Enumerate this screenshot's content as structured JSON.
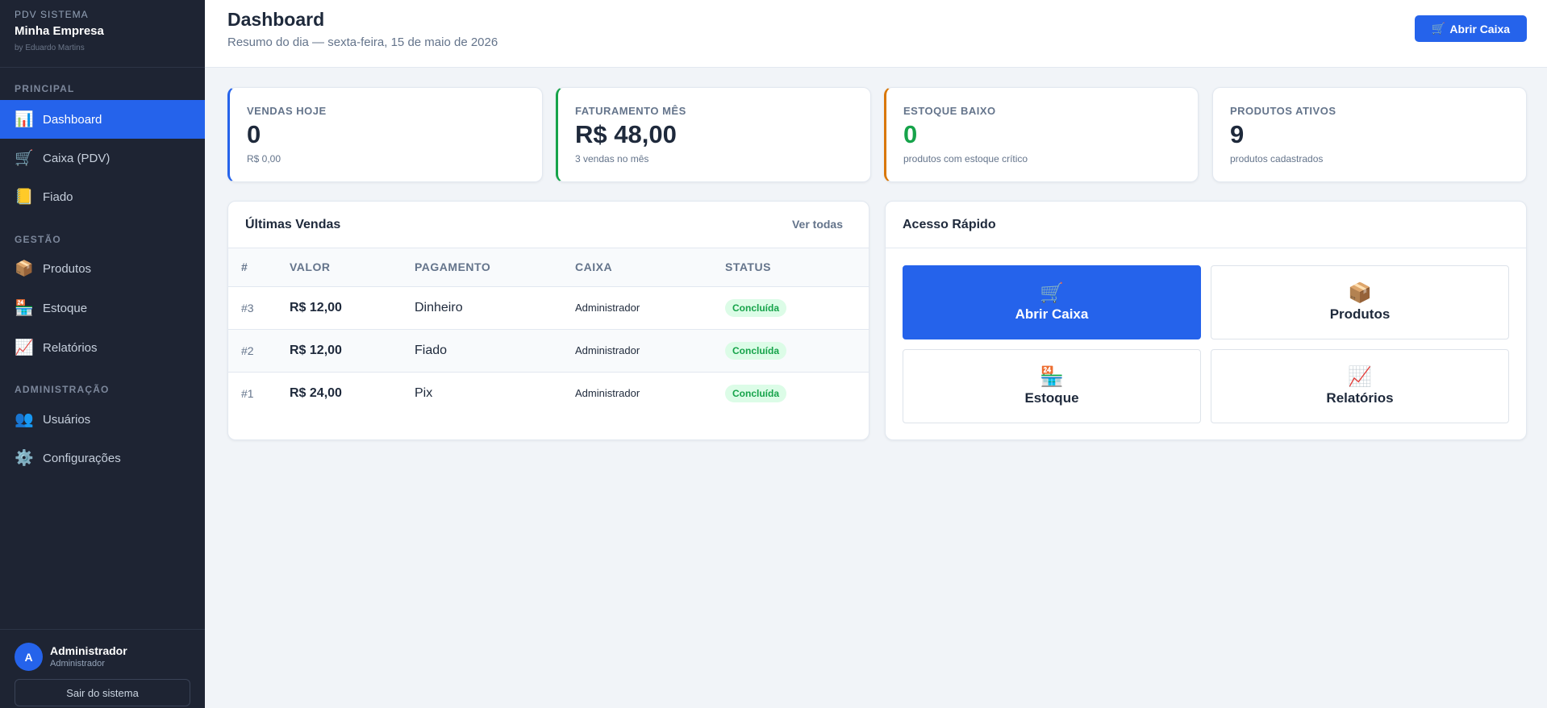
{
  "sidebar": {
    "system": "PDV SISTEMA",
    "company": "Minha Empresa",
    "by": "by Eduardo Martins",
    "sections": [
      {
        "title": "PRINCIPAL"
      },
      {
        "title": "GESTÃO"
      },
      {
        "title": "ADMINISTRAÇÃO"
      }
    ],
    "items": [
      {
        "label": "Dashboard",
        "icon": "📊",
        "active": true
      },
      {
        "label": "Caixa (PDV)",
        "icon": "🛒"
      },
      {
        "label": "Fiado",
        "icon": "📒"
      },
      {
        "label": "Produtos",
        "icon": "📦"
      },
      {
        "label": "Estoque",
        "icon": "🏪"
      },
      {
        "label": "Relatórios",
        "icon": "📈"
      },
      {
        "label": "Usuários",
        "icon": "👥"
      },
      {
        "label": "Configurações",
        "icon": "⚙️"
      }
    ],
    "user": {
      "initial": "A",
      "name": "Administrador",
      "role": "Administrador"
    },
    "logout_label": "Sair do sistema"
  },
  "header": {
    "title": "Dashboard",
    "subtitle": "Resumo do dia — sexta-feira, 15 de maio de 2026",
    "button_icon": "🛒",
    "button_label": "Abrir Caixa"
  },
  "stats": [
    {
      "label": "VENDAS HOJE",
      "value": "0",
      "sub": "R$ 0,00"
    },
    {
      "label": "FATURAMENTO MÊS",
      "value": "R$ 48,00",
      "sub": "3 vendas no mês"
    },
    {
      "label": "ESTOQUE BAIXO",
      "value": "0",
      "sub": "produtos com estoque crítico"
    },
    {
      "label": "PRODUTOS ATIVOS",
      "value": "9",
      "sub": "produtos cadastrados"
    }
  ],
  "sales": {
    "title": "Últimas Vendas",
    "view_all": "Ver todas",
    "columns": [
      "#",
      "VALOR",
      "PAGAMENTO",
      "CAIXA",
      "STATUS"
    ],
    "rows": [
      {
        "id": "#3",
        "valor": "R$ 12,00",
        "pagamento": "Dinheiro",
        "caixa": "Administrador",
        "status": "Concluída"
      },
      {
        "id": "#2",
        "valor": "R$ 12,00",
        "pagamento": "Fiado",
        "caixa": "Administrador",
        "status": "Concluída"
      },
      {
        "id": "#1",
        "valor": "R$ 24,00",
        "pagamento": "Pix",
        "caixa": "Administrador",
        "status": "Concluída"
      }
    ]
  },
  "quick": {
    "title": "Acesso Rápido",
    "items": [
      {
        "icon": "🛒",
        "label": "Abrir Caixa"
      },
      {
        "icon": "📦",
        "label": "Produtos"
      },
      {
        "icon": "🏪",
        "label": "Estoque"
      },
      {
        "icon": "📈",
        "label": "Relatórios"
      }
    ]
  },
  "colors": {
    "primary": "#2563eb",
    "sidebar_bg": "#1e2433",
    "success": "#16a34a",
    "warning": "#d97706"
  }
}
